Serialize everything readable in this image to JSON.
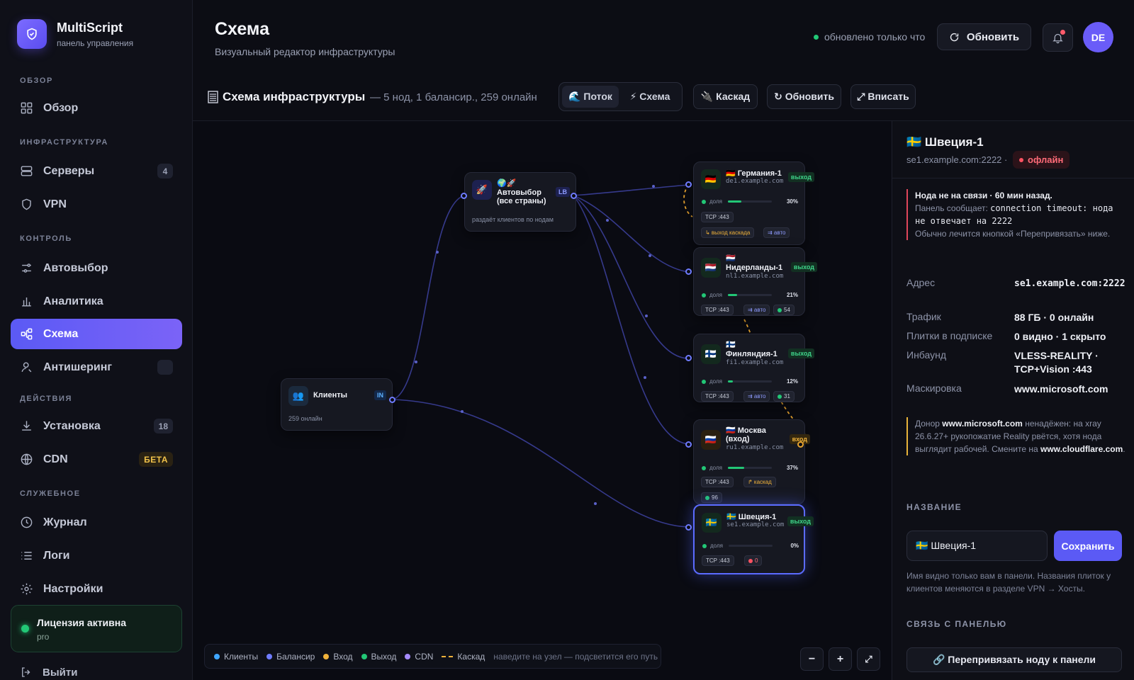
{
  "brand": {
    "name": "MultiScript",
    "subtitle": "панель управления"
  },
  "sidebar": {
    "sections": {
      "overview": "ОБЗОР",
      "infra": "ИНФРАСТРУКТУРА",
      "control": "КОНТРОЛЬ",
      "actions": "ДЕЙСТВИЯ",
      "service": "СЛУЖЕБНОЕ"
    },
    "items": {
      "overview": "Обзор",
      "servers": "Серверы",
      "servers_count": "4",
      "vpn": "VPN",
      "autoselect": "Автовыбор",
      "analytics": "Аналитика",
      "schema": "Схема",
      "antisharing": "Антишеринг",
      "install": "Установка",
      "install_count": "18",
      "cdn": "CDN",
      "cdn_badge": "БЕТА",
      "journal": "Журнал",
      "logs": "Логи",
      "settings": "Настройки"
    },
    "license": {
      "title": "Лицензия активна",
      "plan": "pro"
    },
    "logout": "Выйти"
  },
  "header": {
    "title": "Схема",
    "subtitle": "Визуальный редактор инфраструктуры",
    "status": "обновлено только что",
    "refresh": "Обновить",
    "avatar": "DE"
  },
  "toolbar": {
    "title": "Схема инфраструктуры",
    "stats": "— 5 нод, 1 балансир., 259 онлайн",
    "flow": "🌊 Поток",
    "schema": "⚡ Схема",
    "cascade": "🔌 Каскад",
    "refresh": "↻ Обновить",
    "fit": "⤢ Вписать"
  },
  "nodes": {
    "clients": {
      "title": "Клиенты",
      "tag": "IN",
      "sub": "259 онлайн"
    },
    "balancer": {
      "title1": "🌍🚀",
      "title2": "Автовыбор",
      "title3": "(все страны)",
      "tag": "LB",
      "sub": "раздаёт клиентов по нодам"
    },
    "germany": {
      "title": "🇩🇪 Германия-1",
      "host": "de1.example.com",
      "tag": "выход",
      "share_label": "доля",
      "share": 30,
      "share_text": "30%",
      "proto": "TCP :443",
      "chip1": "↳ выход каскада",
      "chip2": "⇉ авто"
    },
    "netherlands": {
      "flag": "🇳🇱",
      "title": "Нидерланды-1",
      "host": "nl1.example.com",
      "tag": "выход",
      "share_label": "доля",
      "share": 21,
      "share_text": "21%",
      "proto": "TCP :443",
      "chip2": "⇉ авто",
      "online": "54"
    },
    "finland": {
      "flag": "🇫🇮",
      "title": "Финляндия-1",
      "host": "fi1.example.com",
      "tag": "выход",
      "share_label": "доля",
      "share": 12,
      "share_text": "12%",
      "proto": "TCP :443",
      "chip2": "⇉ авто",
      "online": "31"
    },
    "moscow": {
      "title1": "🇷🇺 Москва",
      "title2": "(вход)",
      "host": "ru1.example.com",
      "tag": "вход",
      "share_label": "доля",
      "share": 37,
      "share_text": "37%",
      "proto": "TCP :443",
      "chip2": "↱ каскад",
      "online": "96"
    },
    "sweden": {
      "title": "🇸🇪 Швеция-1",
      "host": "se1.example.com",
      "tag": "выход",
      "share_label": "доля",
      "share": 0,
      "share_text": "0%",
      "proto": "TCP :443",
      "online": "0"
    }
  },
  "legend": {
    "clients": "Клиенты",
    "balancer": "Балансир",
    "entry": "Вход",
    "exit": "Выход",
    "cdn": "CDN",
    "cascade": "Каскад",
    "hint": "наведите на узел — подсветится его путь"
  },
  "zoom": {
    "out": "−",
    "in": "+",
    "fit": "⤢"
  },
  "panel": {
    "title": "🇸🇪 Швеция-1",
    "host": "se1.example.com:2222 ·",
    "status": "офлайн",
    "alert": {
      "headline": "Нода не на связи · 60 мин назад.",
      "panel_says": "Панель сообщает:",
      "message": "connection timeout: нода не отвечает на 2222",
      "advice": "Обычно лечится кнопкой «Перепривязать» ниже."
    },
    "fields": {
      "address_label": "Адрес",
      "address": "se1.example.com:2222",
      "traffic_label": "Трафик",
      "traffic": "88 ГБ · 0 онлайн",
      "tiles_label": "Плитки в подписке",
      "tiles": "0 видно · 1 скрыто",
      "inbound_label": "Инбаунд",
      "inbound": "VLESS-REALITY · TCP+Vision :443",
      "mask_label": "Маскировка",
      "mask": "www.microsoft.com"
    },
    "warn": {
      "donor": "Донор",
      "donor_host": "www.microsoft.com",
      "text": "ненадёжен: на xray 26.6.27+ рукопожатие Reality рвётся, хотя нода выглядит рабочей. Смените на",
      "alt_host": "www.cloudflare.com"
    },
    "name_section": "НАЗВАНИЕ",
    "name_value": "🇸🇪 Швеция-1",
    "save": "Сохранить",
    "name_note": "Имя видно только вам в панели. Названия плиток у клиентов меняются в разделе VPN → Хосты.",
    "link_section": "СВЯЗЬ С ПАНЕЛЬЮ",
    "rebind": "🔗 Перепривязать ноду к панели"
  },
  "colors": {
    "accent": "#5b5af5",
    "clients": "#3fa6ff",
    "balancer": "#6f7cff",
    "entry": "#f0b23a",
    "exit": "#22c776",
    "cdn": "#a58bff",
    "offline": "#ff5262"
  }
}
